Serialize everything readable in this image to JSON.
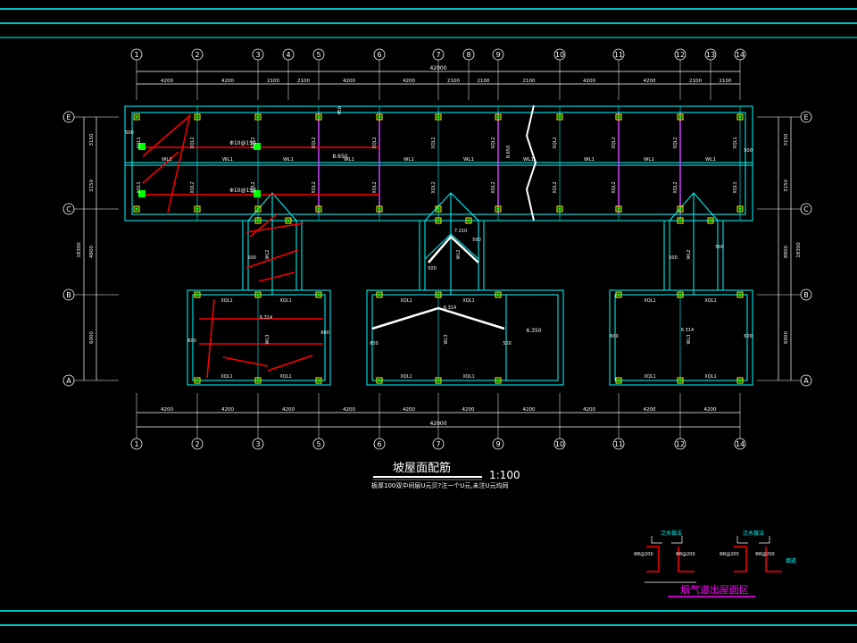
{
  "axes": {
    "top": [
      "1",
      "2",
      "3",
      "4",
      "5",
      "6",
      "7",
      "8",
      "9",
      "10",
      "11",
      "12",
      "13",
      "14"
    ],
    "bottom": [
      "1",
      "2",
      "3",
      "5",
      "6",
      "7",
      "9",
      "10",
      "11",
      "12",
      "14"
    ],
    "rows": [
      "E",
      "C",
      "B",
      "A"
    ]
  },
  "dims": {
    "top_total": "42000",
    "top": [
      "4200",
      "4200",
      "2100",
      "2100",
      "4200",
      "4200",
      "2100",
      "2100",
      "2100",
      "4200",
      "4200",
      "2100",
      "2100"
    ],
    "bottom_total": "42000",
    "bottom": [
      "4200",
      "4200",
      "4200",
      "4200",
      "4200",
      "4200",
      "4200",
      "4200",
      "4200",
      "4200"
    ],
    "left_vert": [
      "3150",
      "3150",
      "4800",
      "6000"
    ],
    "left_total": "18300",
    "right_vert": [
      "3150",
      "3150",
      "8800",
      "6000"
    ],
    "right_total": "18300"
  },
  "labels": {
    "wl1": "WL1",
    "xql1": "XQL1",
    "xql2": "XQL2",
    "wl2": "WL2",
    "wl3": "WL3",
    "rebar1": "Φ10@150",
    "rebar2": "Φ10@150",
    "elev1": "8.650",
    "elev2": "8.650",
    "elev3": "7.210",
    "elev4": "6.314",
    "elev5": "6.350",
    "v500": "500",
    "v600": "600",
    "v450": "450"
  },
  "title": {
    "main": "坡屋面配筋",
    "scale": "1:100",
    "note": "板厚100双中间层U元贝?注一个U元,未注U元均同"
  },
  "detail": {
    "title": "烟气道出屋面区",
    "tag1": "泛水做法",
    "tag2": "泛水做法",
    "tag3": "烟道",
    "txt1": "Φ8@200",
    "txt2": "Φ8@200",
    "txt3": "Φ8@200",
    "txt4": "Φ8@200"
  },
  "colors": {
    "frame": "#00ffff",
    "dim": "#ffffff",
    "rebar": "#ff0000",
    "beam": "#00ffff",
    "column": "#ffff00",
    "green": "#00ff00",
    "purple": "#cc44ff"
  }
}
